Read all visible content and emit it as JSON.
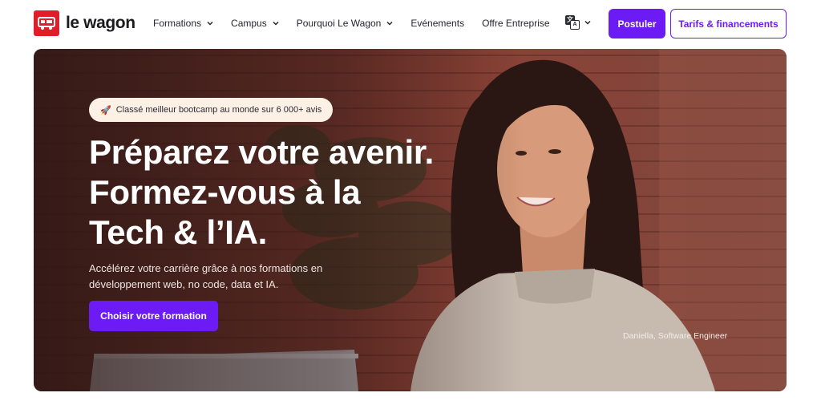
{
  "brand": {
    "name": "le wagon",
    "color": "#e11d2a",
    "accent": "#6d1bf5"
  },
  "nav": {
    "items": [
      {
        "label": "Formations",
        "has_dropdown": true
      },
      {
        "label": "Campus",
        "has_dropdown": true
      },
      {
        "label": "Pourquoi Le Wagon",
        "has_dropdown": true
      },
      {
        "label": "Evénements",
        "has_dropdown": false
      },
      {
        "label": "Offre Entreprise",
        "has_dropdown": false
      }
    ],
    "language_icon": "translate-icon"
  },
  "header_actions": {
    "apply_label": "Postuler",
    "pricing_label": "Tarifs & financements"
  },
  "hero": {
    "badge_icon": "rocket-icon",
    "badge_text": "Classé meilleur bootcamp au monde sur 6 000+ avis",
    "headline": [
      "Préparez votre avenir.",
      "Formez-vous à la",
      "Tech & l’IA."
    ],
    "subtitle": [
      "Accélérez votre carrière grâce à nos formations en",
      "développement web, no code, data et IA."
    ],
    "cta_label": "Choisir votre formation",
    "photo_caption": "Daniella, Software Engineer"
  }
}
